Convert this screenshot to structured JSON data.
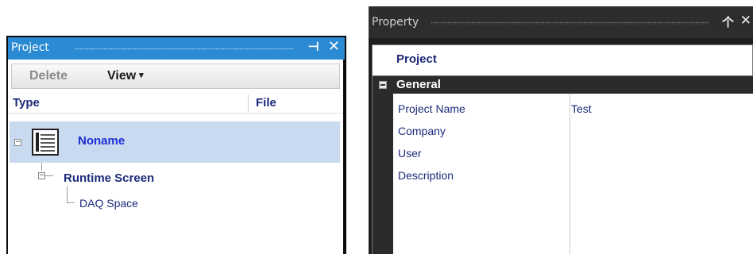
{
  "project_panel": {
    "title": "Project",
    "pin_icon": "pin-icon",
    "close_icon": "close-icon",
    "toolbar": {
      "delete_label": "Delete",
      "view_label": "View"
    },
    "columns": {
      "type": "Type",
      "file": "File"
    },
    "tree": {
      "root": {
        "label": "Noname",
        "icon": "screen-document-icon",
        "selected": true,
        "expanded": true
      },
      "child": {
        "label": "Runtime Screen",
        "expanded": true
      },
      "grandchild": {
        "label": "DAQ Space"
      }
    }
  },
  "property_panel": {
    "title": "Property",
    "pin_icon": "pin-icon",
    "close_icon": "close-icon",
    "header": "Project",
    "category": "General",
    "rows": [
      {
        "name": "Project Name",
        "value": "Test"
      },
      {
        "name": "Company",
        "value": ""
      },
      {
        "name": "User",
        "value": ""
      },
      {
        "name": "Description",
        "value": ""
      }
    ]
  },
  "colors": {
    "project_title_bg": "#2a8ad4",
    "selected_row_bg": "#c9d9f0",
    "node_text_blue": "#1a2fd4",
    "label_navy": "#1b2a7a",
    "property_dark_bg": "#2d2d2d"
  }
}
